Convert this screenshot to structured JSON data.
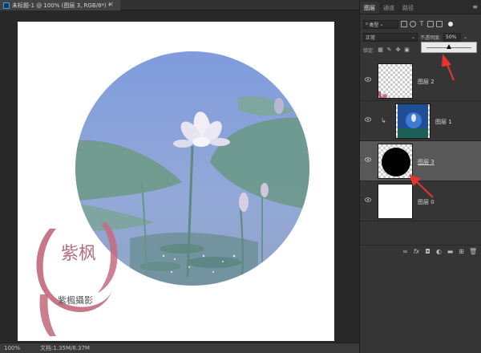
{
  "document": {
    "tab_title": "未标题-1 @ 100% (图层 3, RGB/8*) *",
    "close_glyph": "×"
  },
  "status": {
    "zoom": "100%",
    "doc_info": "文档:1.35M/8.37M"
  },
  "canvas_art": {
    "seal_chars": "紫枫",
    "signature": "紫楓攝影"
  },
  "panel": {
    "tabs": [
      {
        "label": "图层",
        "active": true
      },
      {
        "label": "通道",
        "active": false
      },
      {
        "label": "路径",
        "active": false
      }
    ],
    "menu_glyph": "≡",
    "filter_kind": "类型",
    "blend_mode": "正常",
    "opacity_label": "不透明度:",
    "opacity_value": "50%",
    "opacity_fraction": 0.5,
    "lock_label": "锁定:",
    "layers": [
      {
        "name": "图层 2",
        "selected": false
      },
      {
        "name": "图层 1",
        "selected": false,
        "clipped": true
      },
      {
        "name": "图层 3",
        "selected": true
      },
      {
        "name": "图层 0",
        "selected": false
      }
    ]
  },
  "colors": {
    "accent_blue": "#31a8ff",
    "annotation_red": "#e5342f",
    "selected_row": "#585858"
  }
}
